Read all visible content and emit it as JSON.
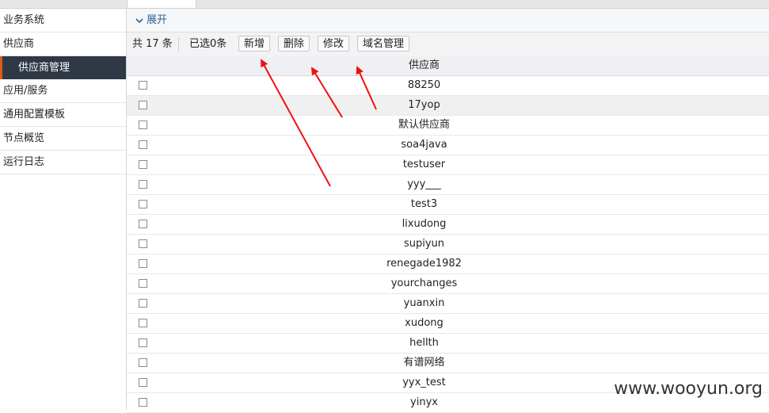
{
  "sidebar": {
    "items": [
      {
        "label": "业务系统"
      },
      {
        "label": "供应商"
      },
      {
        "label": "供应商管理",
        "active": true
      },
      {
        "label": "应用/服务"
      },
      {
        "label": "通用配置模板"
      },
      {
        "label": "节点概览"
      },
      {
        "label": "运行日志"
      }
    ]
  },
  "expand": {
    "label": "展开",
    "icon": "chevron-down-icon"
  },
  "toolbar": {
    "total": "共 17 条",
    "selected": "已选0条",
    "add_label": "新增",
    "delete_label": "删除",
    "edit_label": "修改",
    "domain_label": "域名管理"
  },
  "table": {
    "header": "供应商",
    "rows": [
      "88250",
      "17yop",
      "默认供应商",
      "soa4java",
      "testuser",
      "yyy___",
      "test3",
      "lixudong",
      "supiyun",
      "renegade1982",
      "yourchanges",
      "yuanxin",
      "xudong",
      "hellth",
      "有谱网络",
      "yyx_test",
      "yinyx"
    ]
  },
  "watermark": "www.wooyun.org",
  "colors": {
    "sidebar_active_bg": "#2f3845",
    "sidebar_active_accent": "#e05a18",
    "arrow": "#ee1111",
    "expand_text": "#2a6496"
  }
}
